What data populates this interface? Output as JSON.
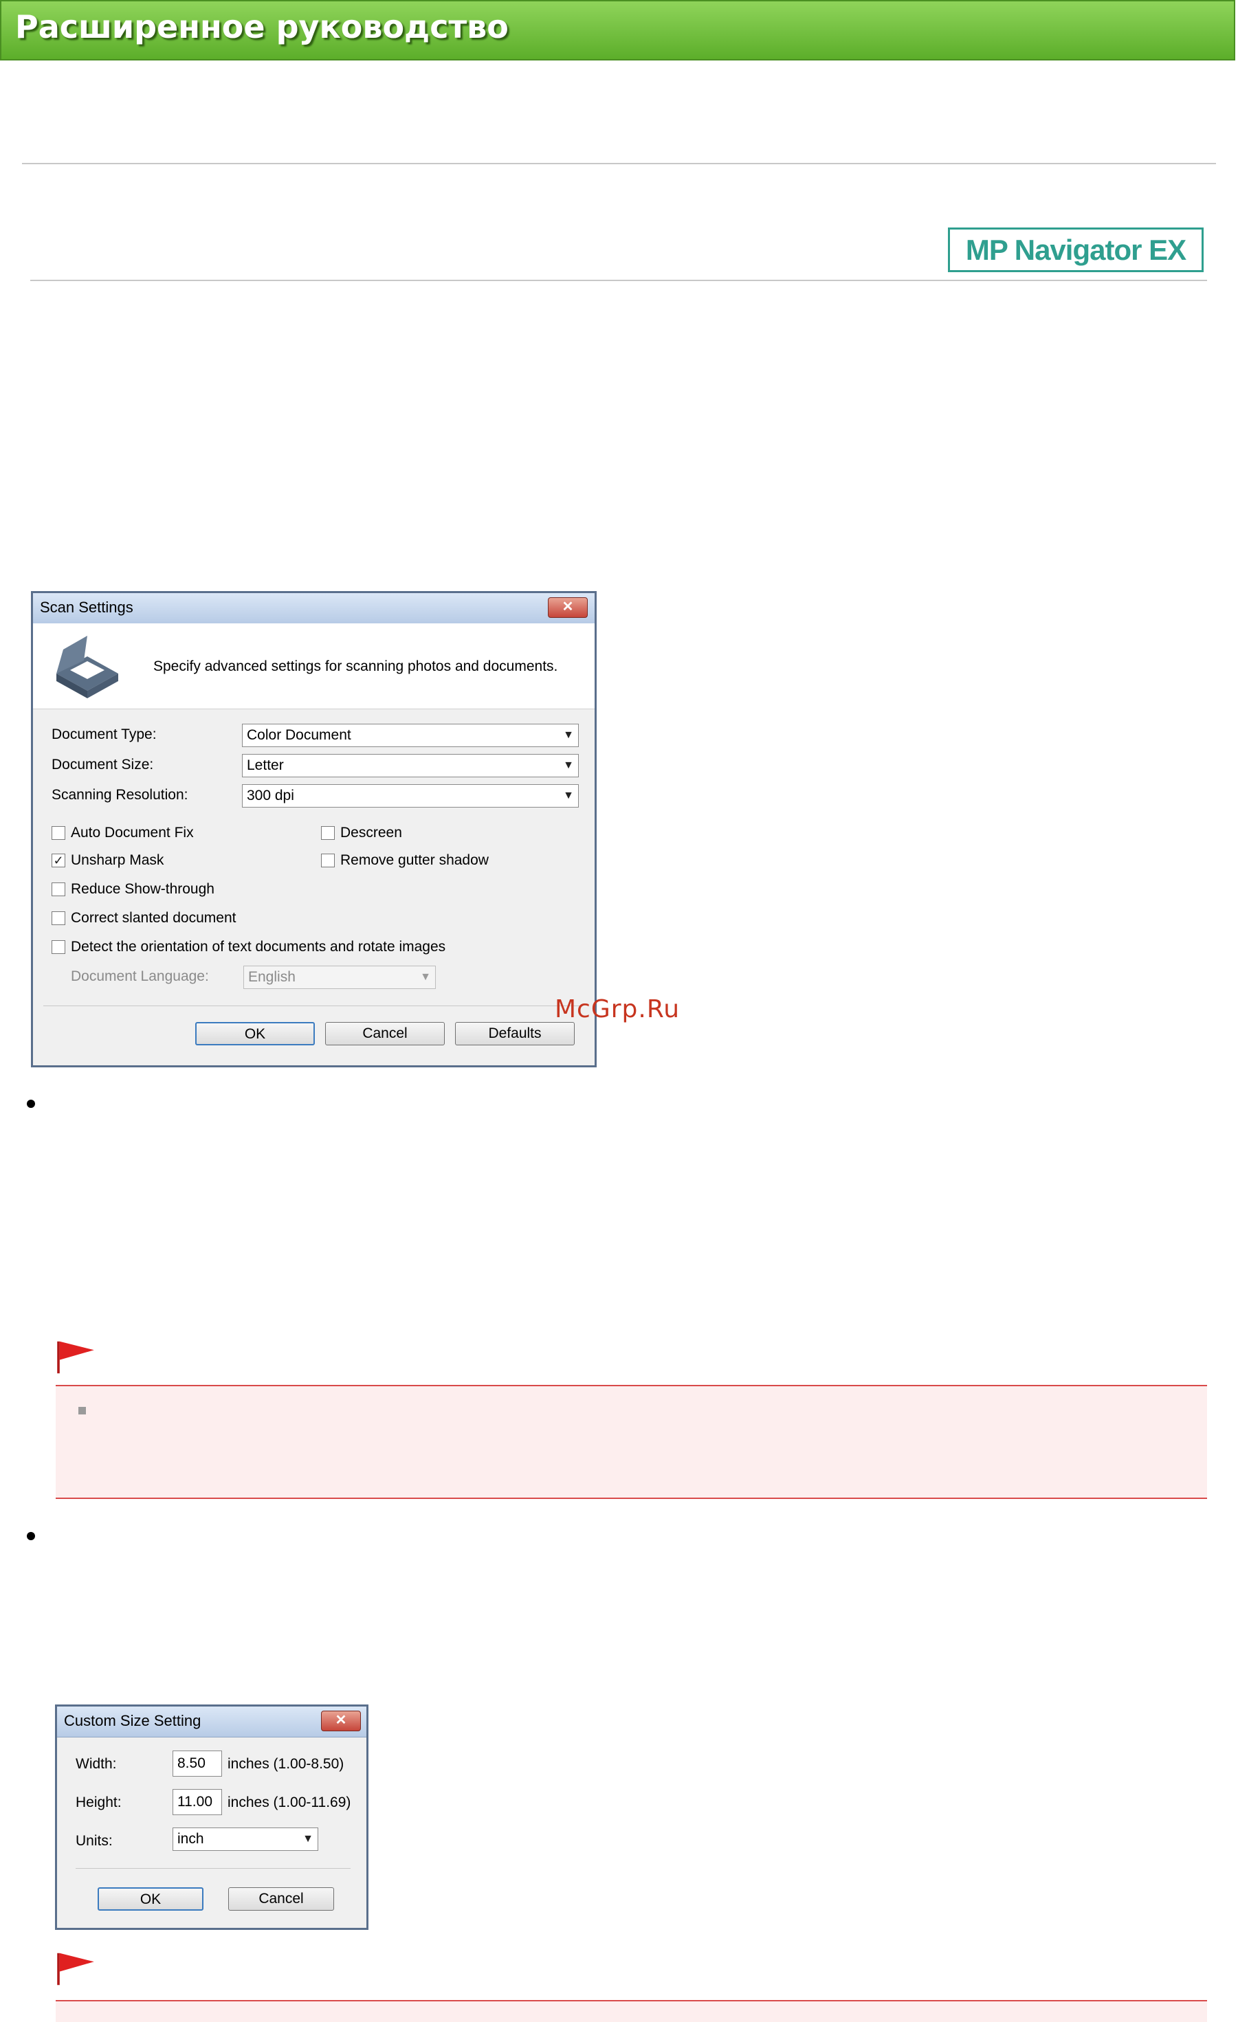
{
  "header": {
    "title": "Расширенное руководство"
  },
  "logo": {
    "text": "MP Navigator EX"
  },
  "watermark": {
    "text": "McGrp.Ru"
  },
  "scan_settings": {
    "title": "Scan Settings",
    "close_label": "✕",
    "description": "Specify advanced settings for scanning photos and documents.",
    "document_type": {
      "label": "Document Type:",
      "value": "Color Document"
    },
    "document_size": {
      "label": "Document Size:",
      "value": "Letter"
    },
    "scanning_resolution": {
      "label": "Scanning Resolution:",
      "value": "300 dpi"
    },
    "auto_document_fix": {
      "label": "Auto Document Fix",
      "checked": false
    },
    "descreen": {
      "label": "Descreen",
      "checked": false
    },
    "unsharp_mask": {
      "label": "Unsharp Mask",
      "checked": true
    },
    "remove_gutter_shadow": {
      "label": "Remove gutter shadow",
      "checked": false
    },
    "reduce_show_through": {
      "label": "Reduce Show-through",
      "checked": false
    },
    "correct_slanted": {
      "label": "Correct slanted document",
      "checked": false
    },
    "detect_orientation": {
      "label": "Detect the orientation of text documents and rotate images",
      "checked": false
    },
    "document_language": {
      "label": "Document Language:",
      "value": "English"
    },
    "ok_label": "OK",
    "cancel_label": "Cancel",
    "defaults_label": "Defaults"
  },
  "custom_size": {
    "title": "Custom Size Setting",
    "close_label": "✕",
    "width": {
      "label": "Width:",
      "value": "8.50",
      "range": "inches (1.00-8.50)"
    },
    "height": {
      "label": "Height:",
      "value": "11.00",
      "range": "inches (1.00-11.69)"
    },
    "units": {
      "label": "Units:",
      "value": "inch"
    },
    "ok_label": "OK",
    "cancel_label": "Cancel"
  },
  "colors": {
    "banner": "#6cc238",
    "logo": "#2f9f8f",
    "note_border": "#d94a4a",
    "note_bg": "#fdeeee",
    "flag": "#e02020"
  },
  "icons": [
    "scanner-icon",
    "close-icon",
    "dropdown-arrow-icon",
    "checkbox-icon",
    "flag-icon"
  ]
}
